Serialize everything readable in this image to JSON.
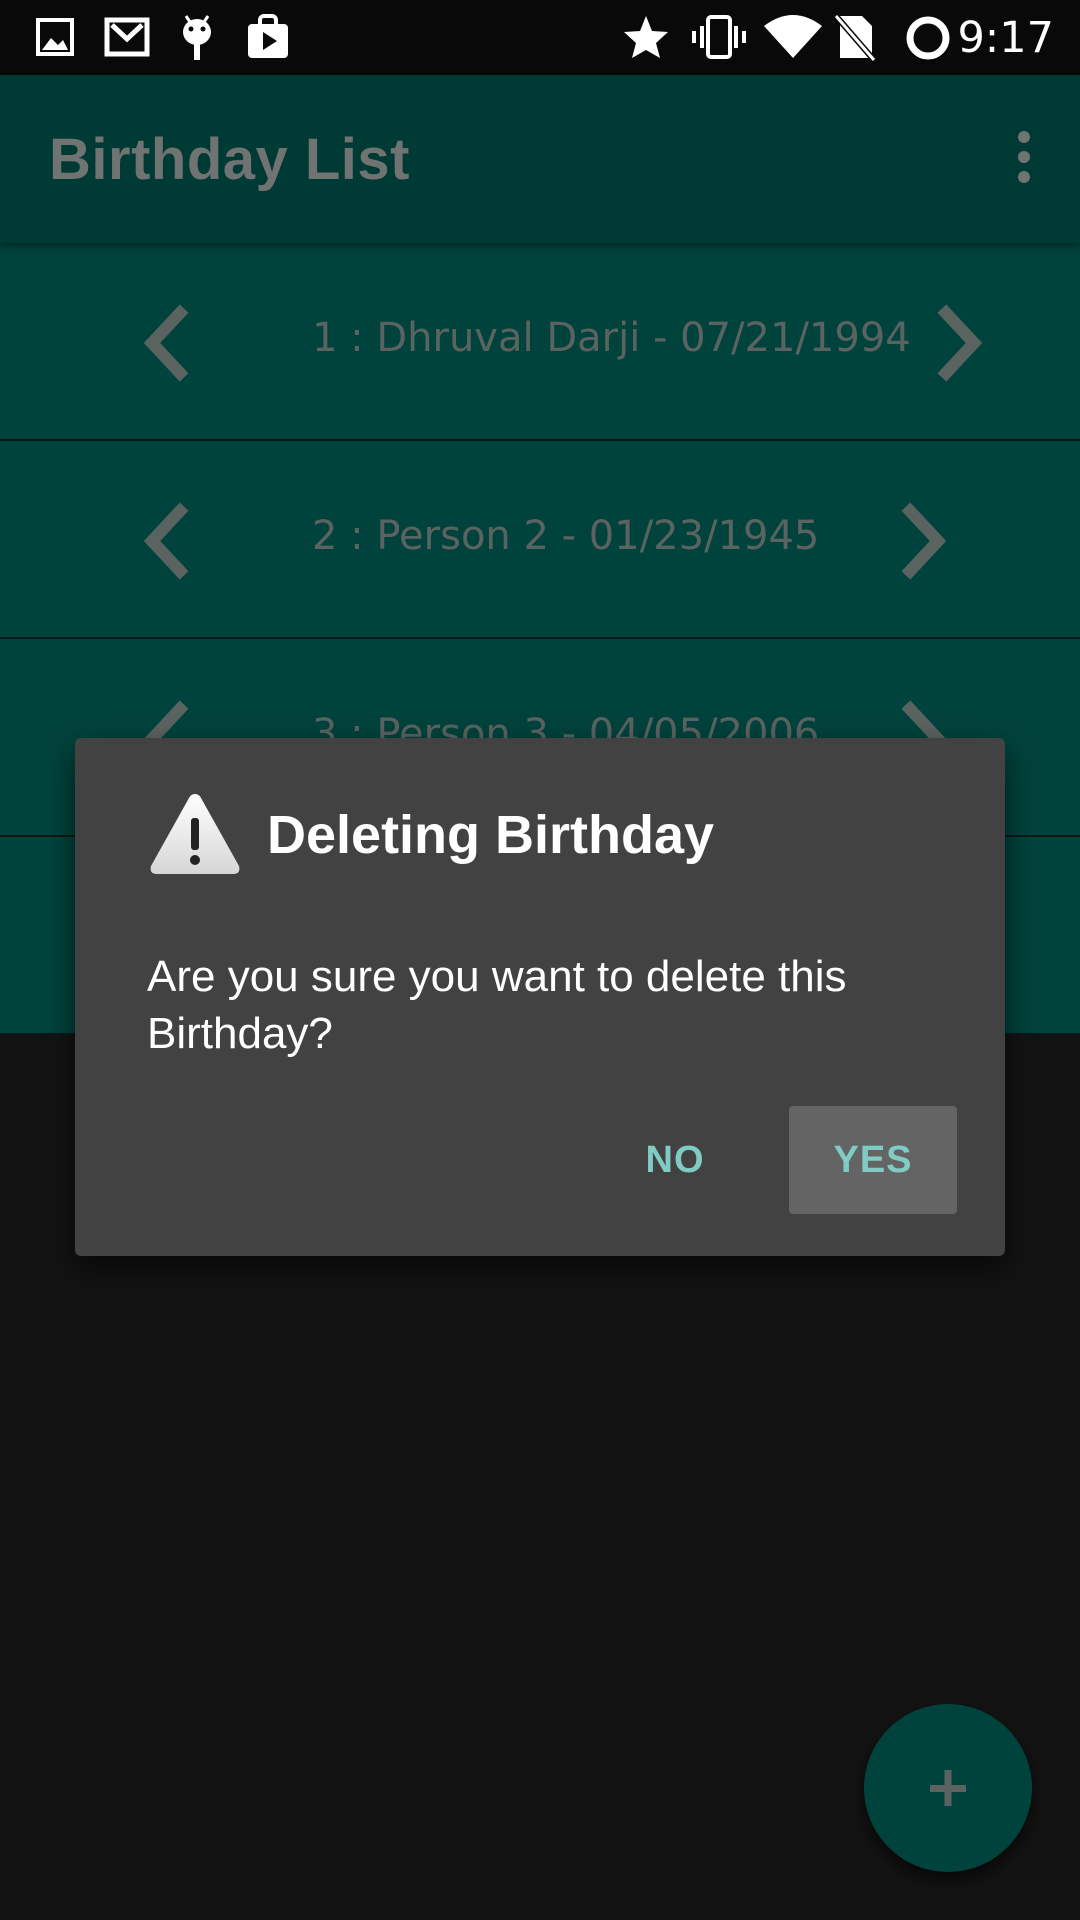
{
  "status_bar": {
    "time": "9:17",
    "left_icons": [
      "image-icon",
      "gmail-icon",
      "android-debug-icon",
      "play-store-bag-icon"
    ],
    "right_icons": [
      "star-icon",
      "vibrate-icon",
      "wifi-icon",
      "no-sim-icon",
      "battery-ring-icon"
    ]
  },
  "app_bar": {
    "title": "Birthday List",
    "overflow_icon": "more-vert-icon"
  },
  "list": {
    "items": [
      {
        "label": "1 : Dhruval Darji - 07/21/1994"
      },
      {
        "label": "2 : Person 2 - 01/23/1945"
      },
      {
        "label": "3 : Person 3 - 04/05/2006"
      },
      {
        "label": ""
      }
    ]
  },
  "dialog": {
    "icon": "warning-icon",
    "title": "Deleting Birthday",
    "message": "Are you sure you want to delete this Birthday?",
    "no_label": "NO",
    "yes_label": "YES"
  },
  "fab": {
    "icon": "plus-icon"
  },
  "colors": {
    "app_bar": "#003a35",
    "list_row": "#00433c",
    "dialog_bg": "#424242",
    "accent_text": "#80cbc4",
    "yes_button_bg": "#646464",
    "background": "#131313"
  }
}
